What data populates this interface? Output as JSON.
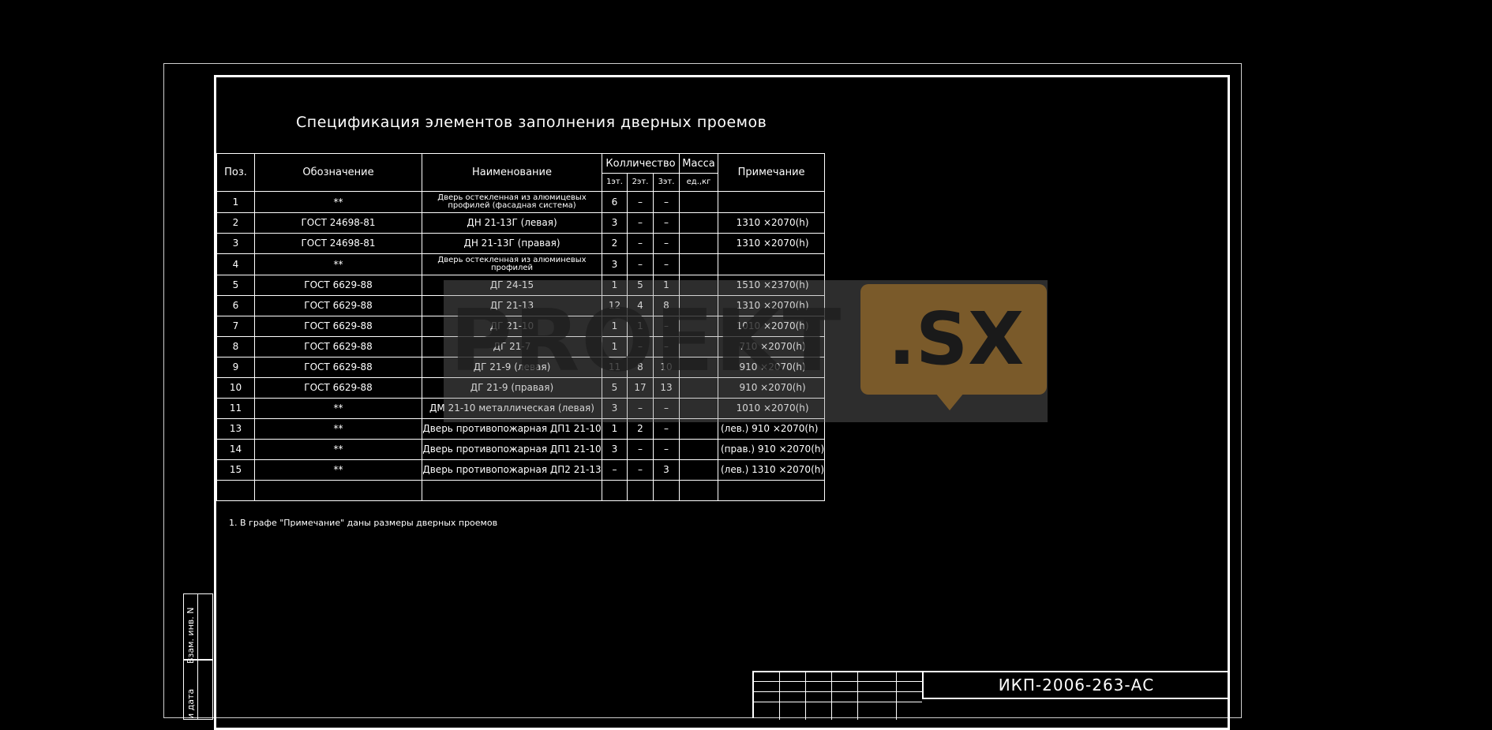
{
  "title": "Спецификация элементов заполнения дверных проемов",
  "headers": {
    "pos": "Поз.",
    "designation": "Обозначение",
    "name": "Наименование",
    "quantity": "Колличество",
    "mass": "Масса",
    "mass_unit": "ед.,кг",
    "note": "Примечание",
    "floor1": "1эт.",
    "floor2": "2эт.",
    "floor3": "3эт."
  },
  "rows": [
    {
      "pos": "1",
      "designation": "**",
      "name": "Дверь остекленная из алюмицевых профилей (фасадная система)",
      "f1": "6",
      "f2": "–",
      "f3": "–",
      "mass": "",
      "note": ""
    },
    {
      "pos": "2",
      "designation": "ГОСТ 24698-81",
      "name": "ДН 21-13Г (левая)",
      "f1": "3",
      "f2": "–",
      "f3": "–",
      "mass": "",
      "note": "1310 ×2070(h)"
    },
    {
      "pos": "3",
      "designation": "ГОСТ 24698-81",
      "name": "ДН 21-13Г (правая)",
      "f1": "2",
      "f2": "–",
      "f3": "–",
      "mass": "",
      "note": "1310 ×2070(h)"
    },
    {
      "pos": "4",
      "designation": "**",
      "name": "Дверь остекленная из алюминевых профилей",
      "f1": "3",
      "f2": "–",
      "f3": "–",
      "mass": "",
      "note": ""
    },
    {
      "pos": "5",
      "designation": "ГОСТ 6629-88",
      "name": "ДГ 24-15",
      "f1": "1",
      "f2": "5",
      "f3": "1",
      "mass": "",
      "note": "1510 ×2370(h)"
    },
    {
      "pos": "6",
      "designation": "ГОСТ 6629-88",
      "name": "ДГ 21-13",
      "f1": "12",
      "f2": "4",
      "f3": "8",
      "mass": "",
      "note": "1310 ×2070(h)"
    },
    {
      "pos": "7",
      "designation": "ГОСТ 6629-88",
      "name": "ДГ 21-10",
      "f1": "1",
      "f2": "1",
      "f3": "–",
      "mass": "",
      "note": "1010 ×2070(h)"
    },
    {
      "pos": "8",
      "designation": "ГОСТ 6629-88",
      "name": "ДГ 21-7",
      "f1": "1",
      "f2": "–",
      "f3": "–",
      "mass": "",
      "note": "710 ×2070(h)"
    },
    {
      "pos": "9",
      "designation": "ГОСТ 6629-88",
      "name": "ДГ 21-9 (левая)",
      "f1": "11",
      "f2": "8",
      "f3": "10",
      "mass": "",
      "note": "910 ×2070(h)"
    },
    {
      "pos": "10",
      "designation": "ГОСТ 6629-88",
      "name": "ДГ 21-9 (правая)",
      "f1": "5",
      "f2": "17",
      "f3": "13",
      "mass": "",
      "note": "910 ×2070(h)"
    },
    {
      "pos": "11",
      "designation": "**",
      "name": "ДМ 21-10 металлическая (левая)",
      "f1": "3",
      "f2": "–",
      "f3": "–",
      "mass": "",
      "note": "1010 ×2070(h)"
    },
    {
      "pos": "13",
      "designation": "**",
      "name": "Дверь противопожарная ДП1 21-10",
      "f1": "1",
      "f2": "2",
      "f3": "–",
      "mass": "",
      "note": "(лев.)   910 ×2070(h)"
    },
    {
      "pos": "14",
      "designation": "**",
      "name": "Дверь противопожарная ДП1 21-10",
      "f1": "3",
      "f2": "–",
      "f3": "–",
      "mass": "",
      "note": "(прав.)  910 ×2070(h)"
    },
    {
      "pos": "15",
      "designation": "**",
      "name": "Дверь противопожарная ДП2 21-13",
      "f1": "–",
      "f2": "–",
      "f3": "3",
      "mass": "",
      "note": "(лев.)  1310 ×2070(h)"
    },
    {
      "pos": "",
      "designation": "",
      "name": "",
      "f1": "",
      "f2": "",
      "f3": "",
      "mass": "",
      "note": ""
    }
  ],
  "footnote": "1. В графе \"Примечание\" даны размеры дверных проемов",
  "watermark": {
    "left": "PROEKT",
    "right": ".SX"
  },
  "side_stamp": {
    "col1": "Взам. инв. N",
    "col2": "и дата"
  },
  "document_code": "ИКП-2006-263-АС"
}
